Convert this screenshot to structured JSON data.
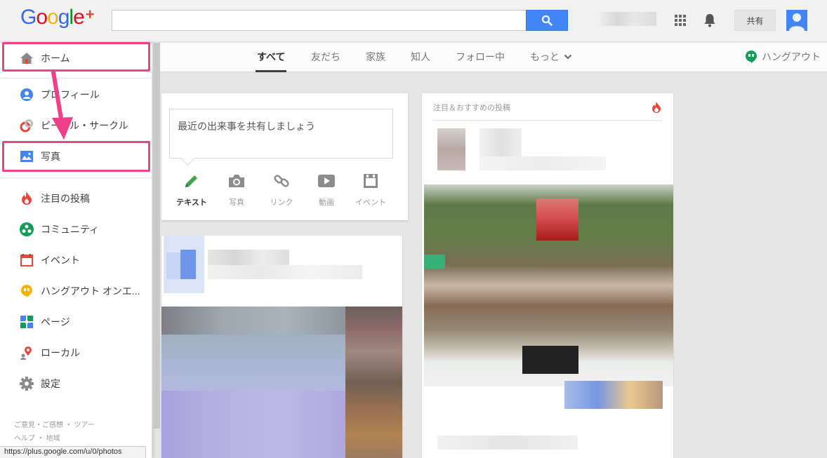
{
  "header": {
    "logo_text": "Google+",
    "search_placeholder": "",
    "share_label": "共有"
  },
  "nav": {
    "tabs": [
      {
        "label": "すべて",
        "active": true
      },
      {
        "label": "友だち"
      },
      {
        "label": "家族"
      },
      {
        "label": "知人"
      },
      {
        "label": "フォロー中"
      },
      {
        "label": "もっと"
      }
    ],
    "hangout_label": "ハングアウト"
  },
  "sidebar": {
    "items": [
      {
        "label": "ホーム",
        "icon": "home-icon"
      },
      {
        "label": "プロフィール",
        "icon": "profile-icon"
      },
      {
        "label": "ピープル・サークル",
        "icon": "circles-icon"
      },
      {
        "label": "写真",
        "icon": "photos-icon"
      },
      {
        "label": "注目の投稿",
        "icon": "fire-icon"
      },
      {
        "label": "コミュニティ",
        "icon": "communities-icon"
      },
      {
        "label": "イベント",
        "icon": "events-icon"
      },
      {
        "label": "ハングアウト オンエ...",
        "icon": "hangouts-icon"
      },
      {
        "label": "ページ",
        "icon": "pages-icon"
      },
      {
        "label": "ローカル",
        "icon": "local-icon"
      },
      {
        "label": "設定",
        "icon": "settings-icon"
      }
    ],
    "footer_line1": "ご意見・ご感想 ・ ツアー",
    "footer_line2": "ヘルプ ・ 地域"
  },
  "share_box": {
    "placeholder": "最近の出来事を共有しましょう",
    "actions": [
      {
        "label": "テキスト",
        "icon": "pencil-icon"
      },
      {
        "label": "写真",
        "icon": "camera-icon"
      },
      {
        "label": "リンク",
        "icon": "link-icon"
      },
      {
        "label": "動画",
        "icon": "video-icon"
      },
      {
        "label": "イベント",
        "icon": "event-icon"
      }
    ]
  },
  "trending": {
    "header": "注目＆おすすめの投稿"
  },
  "status_url": "https://plus.google.com/u/0/photos",
  "colors": {
    "highlight": "#f0408a",
    "search_button": "#4285f4"
  }
}
